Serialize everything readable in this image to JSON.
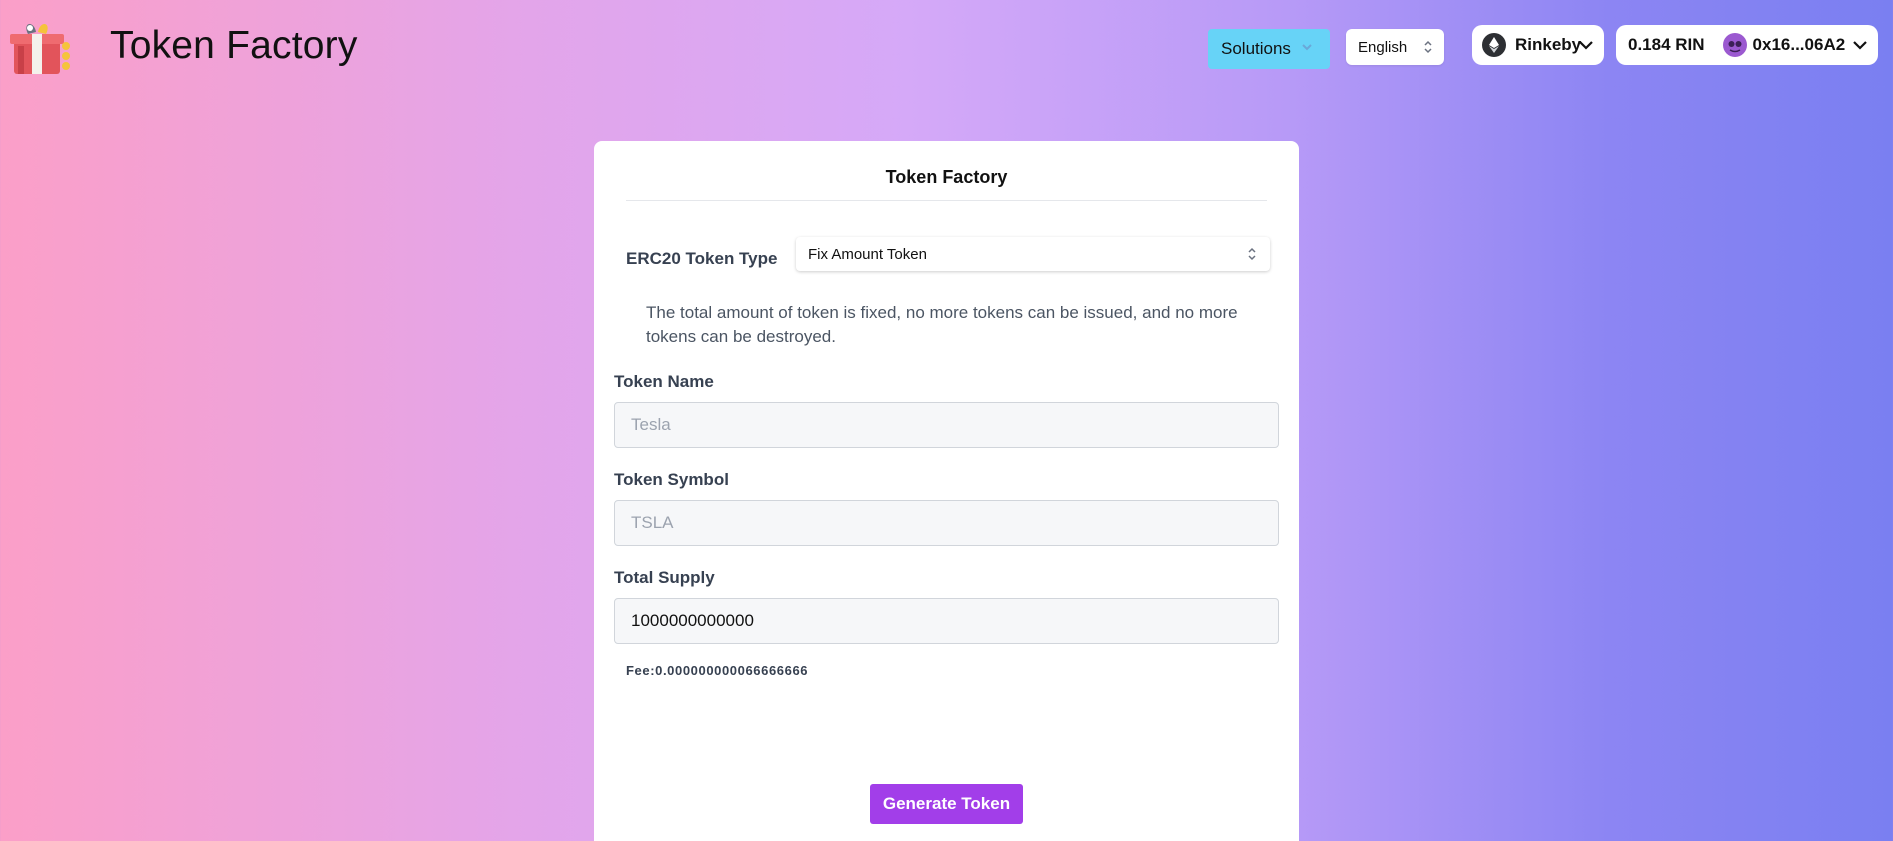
{
  "header": {
    "app_title": "Token Factory",
    "solutions_label": "Solutions",
    "language": "English",
    "network": "Rinkeby",
    "balance": "0.184 RIN",
    "account": "0x16...06A2"
  },
  "card": {
    "title": "Token Factory",
    "type_label": "ERC20 Token Type",
    "type_value": "Fix Amount Token",
    "description": "The total amount of token is fixed, no more tokens can be issued, and no more tokens can be destroyed.",
    "fields": [
      {
        "label": "Token Name",
        "placeholder": "Tesla",
        "value": ""
      },
      {
        "label": "Token Symbol",
        "placeholder": "TSLA",
        "value": ""
      },
      {
        "label": "Total Supply",
        "placeholder": "",
        "value": "1000000000000"
      }
    ],
    "fee": "Fee:0.000000000066666666",
    "generate_label": "Generate Token"
  },
  "colors": {
    "solutions_bg": "#67d3f7",
    "generate_bg": "#a23ee9"
  },
  "icons": [
    "gift-logo-icon",
    "chevron-down-icon",
    "select-updown-icon",
    "ethereum-icon",
    "avatar-icon"
  ]
}
